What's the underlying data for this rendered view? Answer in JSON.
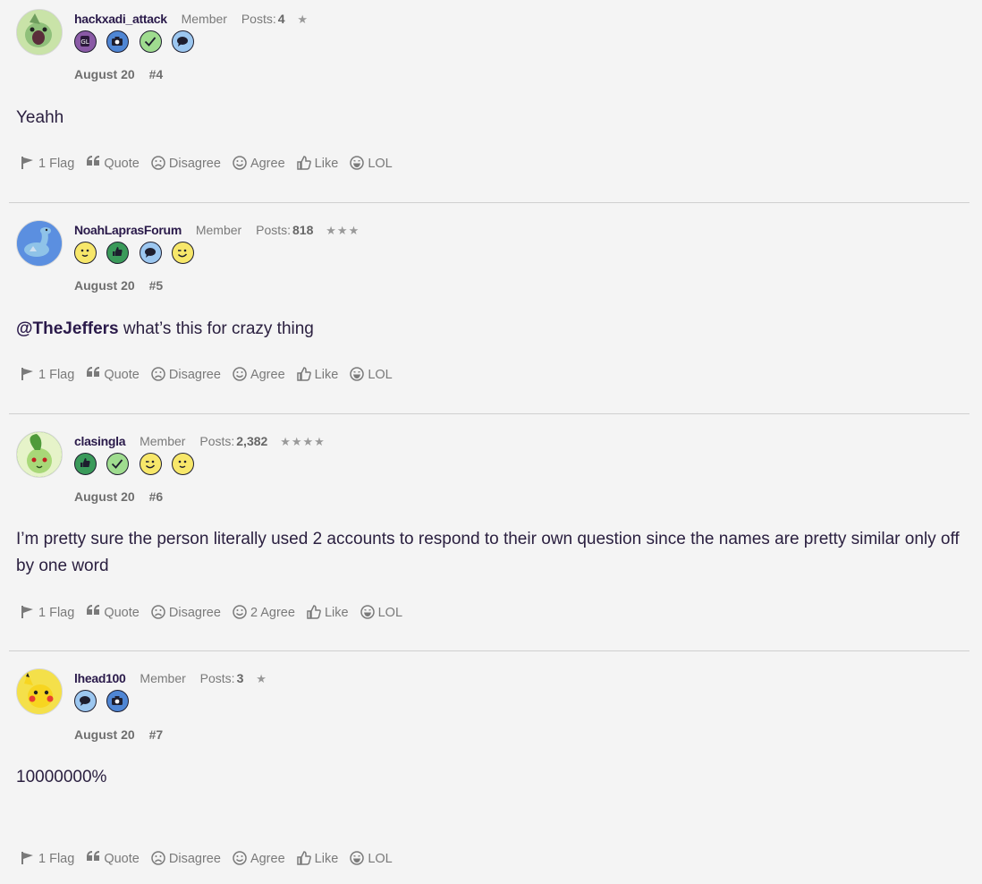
{
  "posts": [
    {
      "username": "hackxadi_attack",
      "role": "Member",
      "posts_label": "Posts:",
      "posts_count": "4",
      "stars": "★",
      "date": "August 20",
      "number": "#4",
      "body": "Yeahh",
      "mention": "",
      "badges": [
        "badge-purple-icon",
        "camera-icon",
        "check-icon",
        "speech-bubble-icon"
      ],
      "actions": {
        "flag": "1 Flag",
        "quote": "Quote",
        "disagree": "Disagree",
        "agree": "Agree",
        "like": "Like",
        "lol": "LOL"
      }
    },
    {
      "username": "NoahLaprasForum",
      "role": "Member",
      "posts_label": "Posts:",
      "posts_count": "818",
      "stars": "★★★",
      "date": "August 20",
      "number": "#5",
      "mention": "@TheJeffers",
      "body": " what’s this for crazy thing",
      "badges": [
        "smiley-icon",
        "thumbs-up-icon",
        "speech-bubble-icon",
        "wink-icon"
      ],
      "actions": {
        "flag": "1 Flag",
        "quote": "Quote",
        "disagree": "Disagree",
        "agree": "Agree",
        "like": "Like",
        "lol": "LOL"
      }
    },
    {
      "username": "clasingla",
      "role": "Member",
      "posts_label": "Posts:",
      "posts_count": "2,382",
      "stars": "★★★★",
      "date": "August 20",
      "number": "#6",
      "mention": "",
      "body": "I’m pretty sure the person literally used 2 accounts to respond to their own question since the names are pretty similar only off by one word",
      "badges": [
        "thumbs-up-icon",
        "check-icon",
        "wink-icon",
        "smiley-icon"
      ],
      "actions": {
        "flag": "1 Flag",
        "quote": "Quote",
        "disagree": "Disagree",
        "agree": "2 Agree",
        "like": "Like",
        "lol": "LOL"
      }
    },
    {
      "username": "lhead100",
      "role": "Member",
      "posts_label": "Posts:",
      "posts_count": "3",
      "stars": "★",
      "date": "August 20",
      "number": "#7",
      "mention": "",
      "body": "10000000%",
      "badges": [
        "speech-bubble-icon",
        "camera-icon"
      ],
      "actions": {
        "flag": "1 Flag",
        "quote": "Quote",
        "disagree": "Disagree",
        "agree": "Agree",
        "like": "Like",
        "lol": "LOL"
      }
    }
  ],
  "colors": {
    "background": "#f4f4f4",
    "username": "#2a1a4a",
    "muted": "#7a7a7a",
    "divider": "#cfcfcf"
  }
}
